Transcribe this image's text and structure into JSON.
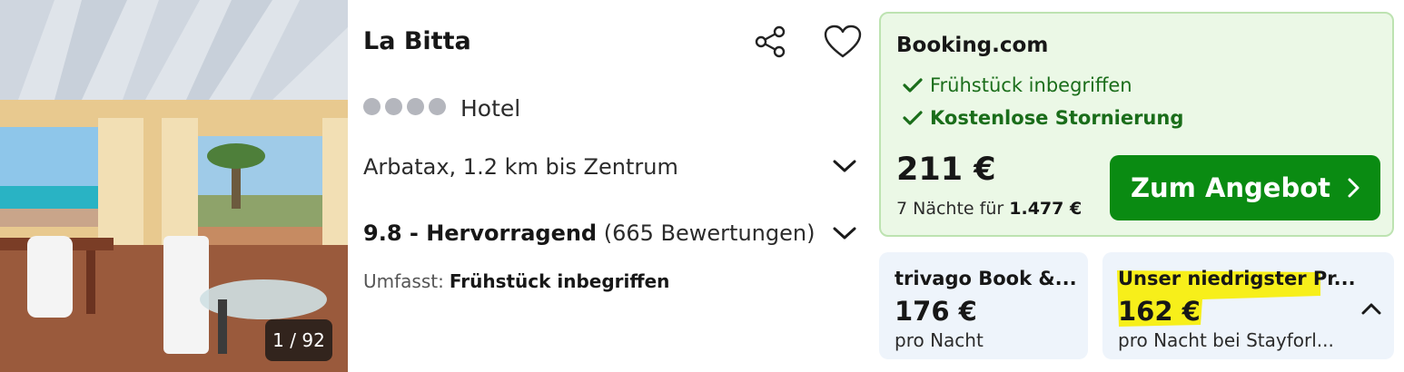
{
  "photo": {
    "counter": "1 / 92"
  },
  "hotel": {
    "name": "La Bitta",
    "stars": 4,
    "type": "Hotel",
    "location": "Arbatax, 1.2 km bis Zentrum",
    "rating_score": "9.8 - Hervorragend",
    "rating_count": "(665 Bewertungen)",
    "includes_label": "Umfasst:",
    "includes_value": "Frühstück inbegriffen"
  },
  "icons": {
    "share": "share-icon",
    "favorite": "heart-icon",
    "expand": "chevron-down-icon",
    "collapse": "chevron-up-icon",
    "check": "checkmark-icon",
    "cta_arrow": "chevron-right-icon"
  },
  "deal": {
    "provider": "Booking.com",
    "perks": [
      "Frühstück inbegriffen",
      "Kostenlose Stornierung"
    ],
    "price": "211 €",
    "total_prefix": "7 Nächte für",
    "total_value": "1.477 €",
    "cta_label": "Zum Angebot"
  },
  "alternatives": [
    {
      "name": "trivago Book &...",
      "price": "176 €",
      "sub": "pro Nacht"
    },
    {
      "name": "Unser niedrigster Pr...",
      "price": "162 €",
      "sub": "pro Nacht bei Stayforl..."
    }
  ],
  "colors": {
    "deal_bg": "#ebf8e6",
    "deal_border": "#bde3b1",
    "perk_green": "#1a6d1a",
    "cta_green": "#0a8b12",
    "alt_bg": "#eef4fb",
    "highlight_yellow": "#f7ef1a",
    "star_gray": "#b4b6bd"
  }
}
